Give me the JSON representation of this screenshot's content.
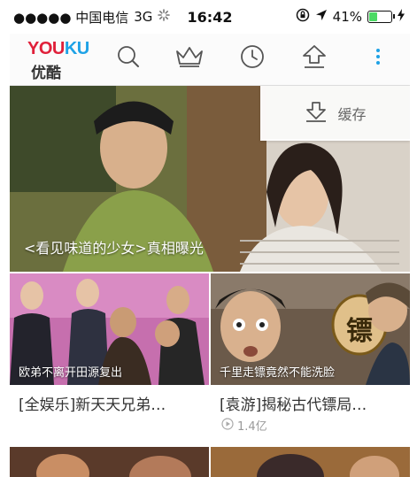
{
  "status_bar": {
    "carrier": "●●●●● 中国电信",
    "network": "3G",
    "time": "16:42",
    "battery": "41%",
    "battery_level": 0.41,
    "battery_color": "#4cd964",
    "icons": [
      "orientation-lock-icon",
      "location-arrow-icon",
      "charging-bolt-icon"
    ]
  },
  "navbar": {
    "logo_en_you": "YOU",
    "logo_en_ku": "KU",
    "logo_cn": "优酷",
    "icons": [
      "search-icon",
      "crown-icon",
      "history-clock-icon",
      "upload-icon",
      "more-vertical-icon"
    ],
    "accent": "#1ea2e6",
    "brand_red": "#e0203a"
  },
  "dropdown": {
    "cache_label": "缓存",
    "icon": "download-icon"
  },
  "hero": {
    "caption": "<看见味道的少女>真相曝光"
  },
  "cards": [
    {
      "thumb_caption": "欧弟不离开田源复出",
      "title": "[全娱乐]新天天兄弟…",
      "meta": ""
    },
    {
      "thumb_caption": "千里走镖竟然不能洗脸",
      "title": "[袁游]揭秘古代镖局…",
      "meta": "1.4亿",
      "meta_icon": "play-circle-icon",
      "badge": "镖"
    }
  ]
}
